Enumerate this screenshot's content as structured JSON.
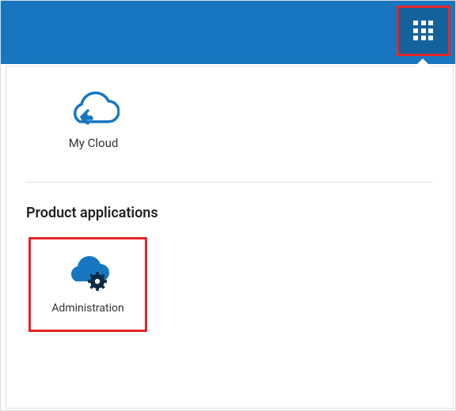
{
  "header": {
    "apps_button_name": "apps-launcher"
  },
  "shortcuts": [
    {
      "label": "My Cloud",
      "icon": "cloud-back-icon"
    }
  ],
  "sections": {
    "product_applications_title": "Product applications",
    "apps": [
      {
        "label": "Administration",
        "icon": "cloud-gear-icon"
      }
    ]
  },
  "colors": {
    "accent": "#1776bf",
    "highlight_border": "#e3252a"
  }
}
